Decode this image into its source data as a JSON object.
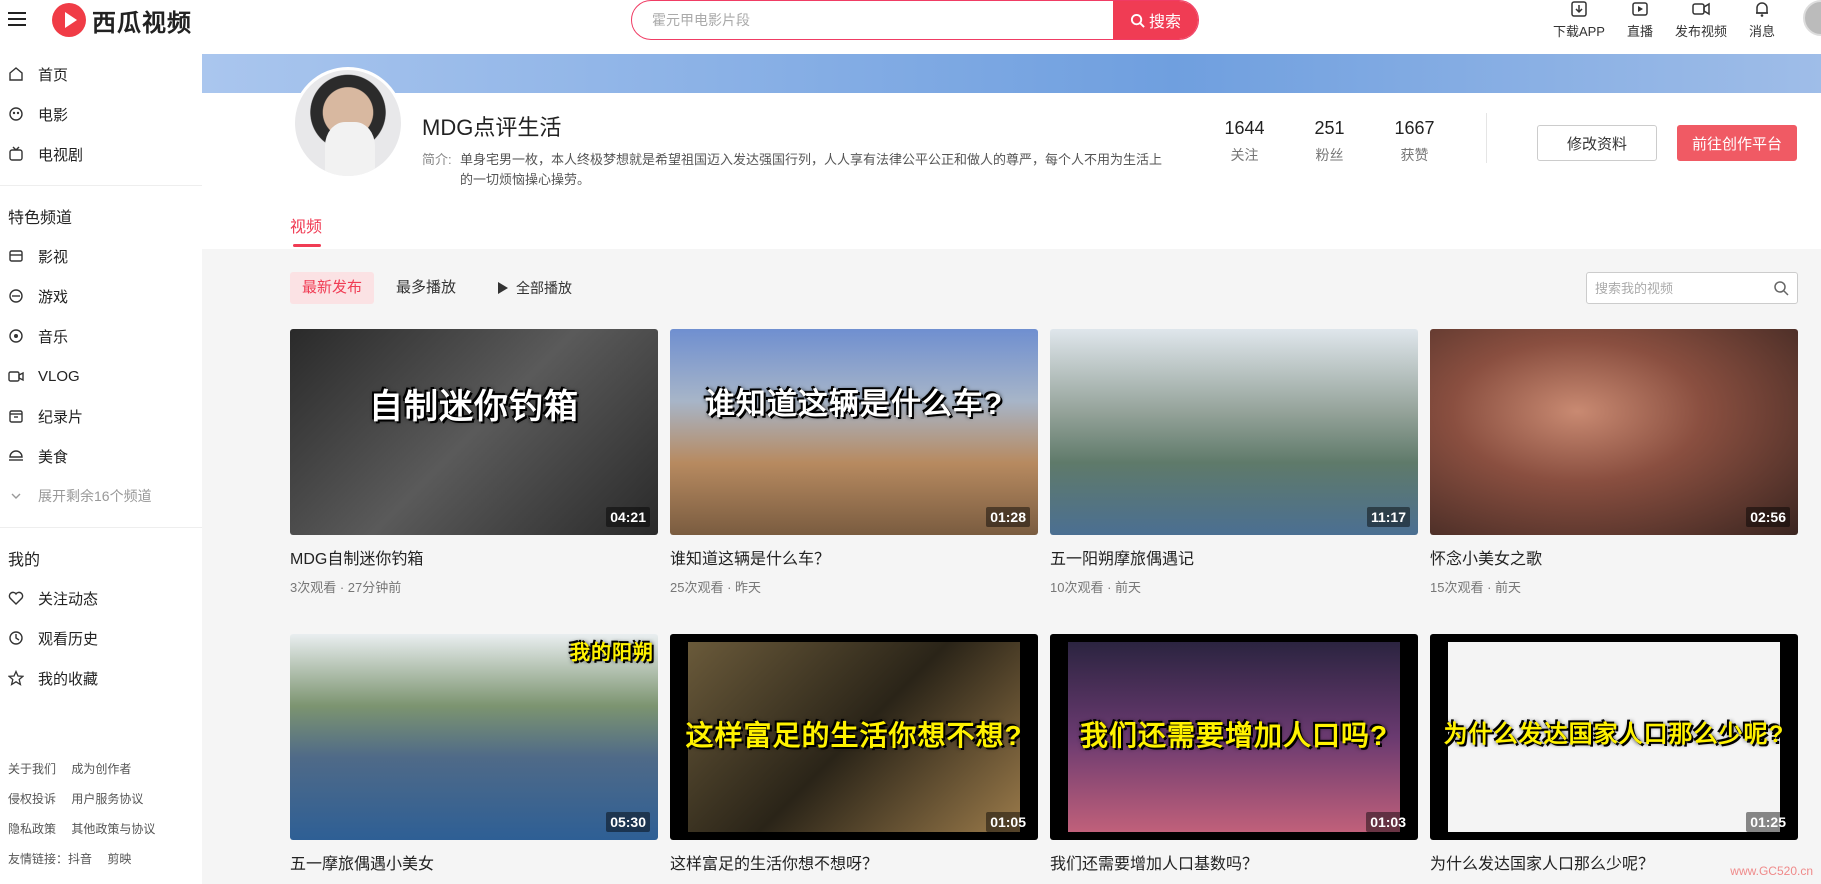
{
  "header": {
    "logo_text": "西瓜视频",
    "search_placeholder": "霍元甲电影片段",
    "search_button": "搜索",
    "actions": [
      {
        "label": "下载APP",
        "icon": "download-icon"
      },
      {
        "label": "直播",
        "icon": "live-icon"
      },
      {
        "label": "发布视频",
        "icon": "upload-video-icon"
      },
      {
        "label": "消息",
        "icon": "bell-icon"
      }
    ]
  },
  "sidebar": {
    "main_items": [
      {
        "label": "首页",
        "icon": "home-icon"
      },
      {
        "label": "电影",
        "icon": "film-icon"
      },
      {
        "label": "电视剧",
        "icon": "tv-icon"
      }
    ],
    "channels_title": "特色频道",
    "channels": [
      {
        "label": "影视",
        "icon": "movie-icon"
      },
      {
        "label": "游戏",
        "icon": "game-icon"
      },
      {
        "label": "音乐",
        "icon": "music-icon"
      },
      {
        "label": "VLOG",
        "icon": "vlog-icon"
      },
      {
        "label": "纪录片",
        "icon": "documentary-icon"
      },
      {
        "label": "美食",
        "icon": "food-icon"
      }
    ],
    "expand_label": "展开剩余16个频道",
    "mine_title": "我的",
    "mine_items": [
      {
        "label": "关注动态",
        "icon": "heart-icon"
      },
      {
        "label": "观看历史",
        "icon": "clock-icon"
      },
      {
        "label": "我的收藏",
        "icon": "star-icon"
      }
    ],
    "footer_rows": [
      [
        "关于我们",
        "成为创作者"
      ],
      [
        "侵权投诉",
        "用户服务协议"
      ],
      [
        "隐私政策",
        "其他政策与协议"
      ],
      [
        "友情链接：抖音",
        "剪映"
      ]
    ]
  },
  "profile": {
    "name": "MDG点评生活",
    "intro_label": "简介:",
    "intro": "单身宅男一枚，本人终极梦想就是希望祖国迈入发达强国行列，人人享有法律公平公正和做人的尊严，每个人不用为生活上的一切烦恼操心操劳。",
    "stats": [
      {
        "value": "1644",
        "label": "关注"
      },
      {
        "value": "251",
        "label": "粉丝"
      },
      {
        "value": "1667",
        "label": "获赞"
      }
    ],
    "edit_button": "修改资料",
    "creator_button": "前往创作平台",
    "tab": "视频"
  },
  "toolbar": {
    "sort_latest": "最新发布",
    "sort_most": "最多播放",
    "play_all": "全部播放",
    "search_placeholder": "搜索我的视频"
  },
  "videos": [
    {
      "title": "MDG自制迷你钓箱",
      "meta": "3次观看 · 27分钟前",
      "duration": "04:21",
      "thumb_text": "自制迷你钓箱",
      "bg": "#3a3a3a"
    },
    {
      "title": "谁知道这辆是什么车？",
      "meta": "25次观看 · 昨天",
      "duration": "01:28",
      "thumb_text": "谁知道这辆是什么车?",
      "bg": "#8a6a50"
    },
    {
      "title": "五一阳朔摩旅偶遇记",
      "meta": "10次观看 · 前天",
      "duration": "11:17",
      "thumb_text": "",
      "bg": "#6f8ea8"
    },
    {
      "title": "怀念小美女之歌",
      "meta": "15次观看 · 前天",
      "duration": "02:56",
      "thumb_text": "",
      "bg": "#7a4a3e"
    },
    {
      "title": "五一摩旅偶遇小美女",
      "meta": "",
      "duration": "05:30",
      "thumb_text": "我的阳朔",
      "bg": "#4d7aa0"
    },
    {
      "title": "这样富足的生活你想不想呀？",
      "meta": "",
      "duration": "01:05",
      "thumb_text": "这样富足的生活你想不想?",
      "bg": "#5a4a30"
    },
    {
      "title": "我们还需要增加人口基数吗？",
      "meta": "",
      "duration": "01:03",
      "thumb_text": "我们还需要增加人口吗?",
      "bg": "#3a3050"
    },
    {
      "title": "为什么发达国家人口那么少呢？",
      "meta": "",
      "duration": "01:25",
      "thumb_text": "为什么发达国家人口那么少呢?",
      "bg": "#e8e8e8"
    }
  ],
  "watermark": "www.GC520.cn"
}
